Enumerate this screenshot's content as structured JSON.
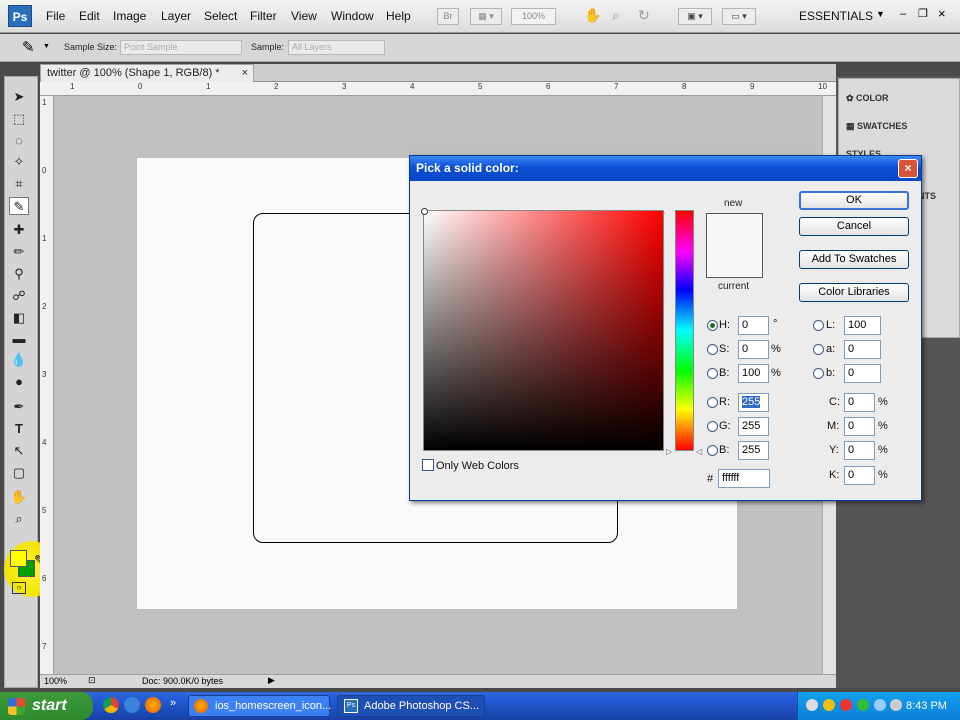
{
  "menubar": {
    "logo": "Ps",
    "items": [
      "File",
      "Edit",
      "Image",
      "Layer",
      "Select",
      "Filter",
      "View",
      "Window",
      "Help"
    ],
    "bridge_label": "Br",
    "zoom": "100%",
    "workspace": "ESSENTIALS"
  },
  "options": {
    "sample_size_label": "Sample Size:",
    "sample_size_value": "Point Sample",
    "sample_label": "Sample:",
    "sample_value": "All Layers"
  },
  "document": {
    "tab_title": "twitter @ 100% (Shape 1, RGB/8) *",
    "ruler_top_labels": [
      "1",
      "0",
      "1",
      "2",
      "3",
      "4",
      "5",
      "6",
      "7",
      "8",
      "9",
      "10"
    ],
    "ruler_left_labels": [
      "1",
      "0",
      "1",
      "2",
      "3",
      "4",
      "5",
      "6",
      "7"
    ],
    "zoom": "100%",
    "doc_info": "Doc: 900.0K/0 bytes"
  },
  "panels": {
    "items": [
      "COLOR",
      "SWATCHES",
      "STYLES",
      "NTS"
    ]
  },
  "dialog": {
    "title": "Pick a solid color:",
    "close": "×",
    "new_label": "new",
    "current_label": "current",
    "buttons": {
      "ok": "OK",
      "cancel": "Cancel",
      "add_swatches": "Add To Swatches",
      "libraries": "Color Libraries"
    },
    "hsb": [
      {
        "label": "H:",
        "value": "0",
        "unit": "°",
        "selected": true
      },
      {
        "label": "S:",
        "value": "0",
        "unit": "%",
        "selected": false
      },
      {
        "label": "B:",
        "value": "100",
        "unit": "%",
        "selected": false
      }
    ],
    "rgb": [
      {
        "label": "R:",
        "value": "255"
      },
      {
        "label": "G:",
        "value": "255"
      },
      {
        "label": "B:",
        "value": "255"
      }
    ],
    "lab": [
      {
        "label": "L:",
        "value": "100"
      },
      {
        "label": "a:",
        "value": "0"
      },
      {
        "label": "b:",
        "value": "0"
      }
    ],
    "cmyk": [
      {
        "label": "C:",
        "value": "0",
        "unit": "%"
      },
      {
        "label": "M:",
        "value": "0",
        "unit": "%"
      },
      {
        "label": "Y:",
        "value": "0",
        "unit": "%"
      },
      {
        "label": "K:",
        "value": "0",
        "unit": "%"
      }
    ],
    "hex_label": "#",
    "hex_value": "ffffff",
    "only_web_colors": "Only Web Colors"
  },
  "taskbar": {
    "start": "start",
    "tasks": [
      "ios_homescreen_icon...",
      "Adobe Photoshop CS..."
    ],
    "clock": "8:43 PM"
  },
  "colors": {
    "foreground": "#ffff00",
    "background": "#00a000",
    "xp_blue": "#245edb"
  }
}
